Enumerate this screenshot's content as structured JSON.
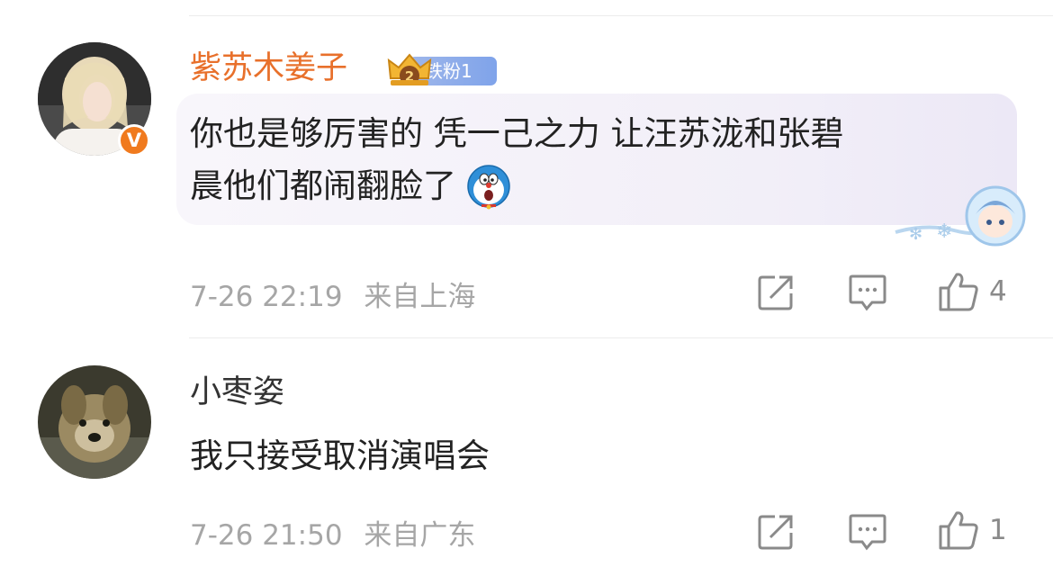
{
  "comments": [
    {
      "username": "紫苏木姜子",
      "username_color": "#e8702b",
      "verified_badge": "V",
      "fan_badge": "铁粉1",
      "text_line1": "你也是够厉害的 凭一己之力 让汪苏泷和张碧",
      "text_line2": "晨他们都闹翻脸了",
      "emoji": "doraemon-emoji",
      "date": "7-26 22:19",
      "location": "来自上海",
      "like_count": "4",
      "icons": [
        "share-icon",
        "comment-icon",
        "like-icon"
      ]
    },
    {
      "username": "小枣姿",
      "username_color": "#333333",
      "text": "我只接受取消演唱会",
      "date": "7-26 21:50",
      "location": "来自广东",
      "like_count": "1",
      "icons": [
        "share-icon",
        "comment-icon",
        "like-icon"
      ]
    }
  ]
}
